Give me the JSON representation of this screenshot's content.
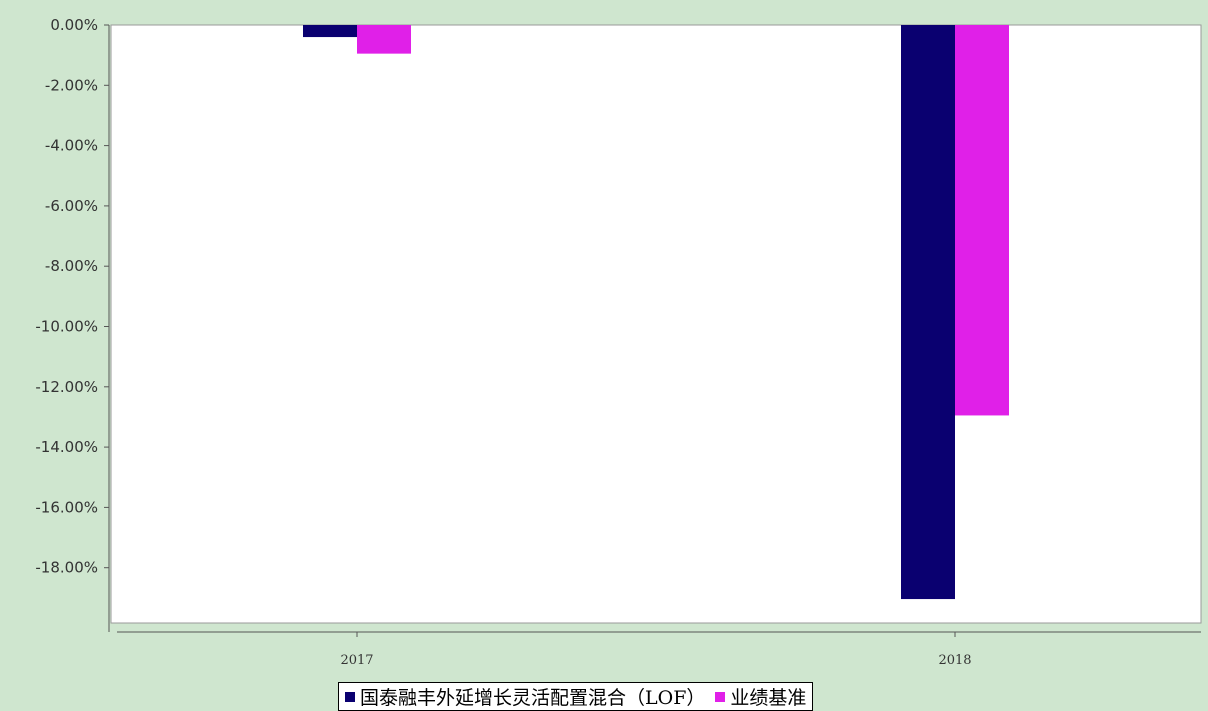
{
  "chart_data": {
    "type": "bar",
    "categories": [
      "2017",
      "2018"
    ],
    "series": [
      {
        "name": "国泰融丰外延增长灵活配置混合（LOF）",
        "color": "#0a0070",
        "values": [
          -0.4,
          -19.04
        ]
      },
      {
        "name": "业绩基准",
        "color": "#e020e8",
        "values": [
          -0.95,
          -12.95
        ]
      }
    ],
    "yticks": [
      "0.00%",
      "-2.00%",
      "-4.00%",
      "-6.00%",
      "-8.00%",
      "-10.00%",
      "-12.00%",
      "-14.00%",
      "-16.00%",
      "-18.00%"
    ],
    "ylim": [
      -20,
      0
    ],
    "grid": false,
    "legend_position": "bottom-center",
    "colors": {
      "background": "#cfe6cf",
      "plot_area": "#ffffff",
      "axis": "#555555"
    }
  }
}
